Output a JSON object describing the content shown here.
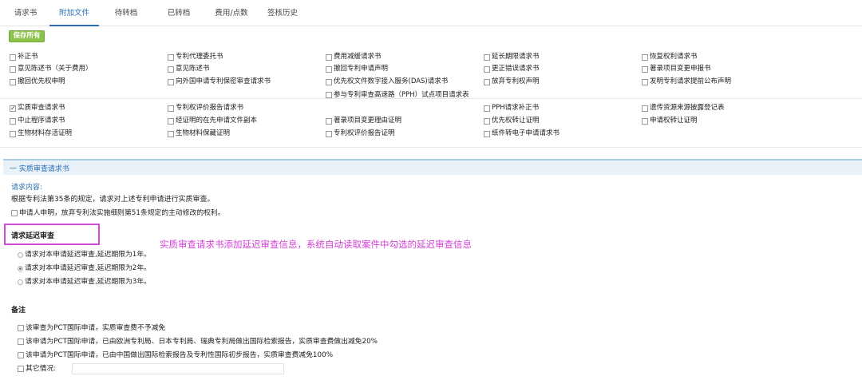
{
  "tabs": [
    "请求书",
    "附加文件",
    "待转档",
    "已转档",
    "费用/点数",
    "签核历史"
  ],
  "save_all": "保存所有",
  "documents": [
    {
      "label": "补正书",
      "checked": false
    },
    {
      "label": "专利代理委托书",
      "checked": false
    },
    {
      "label": "费用减缓请求书",
      "checked": false
    },
    {
      "label": "延长期限请求书",
      "checked": false
    },
    {
      "label": "恢复权利请求书",
      "checked": false
    },
    {
      "label": "意见陈述书（关于费用）",
      "checked": false
    },
    {
      "label": "意见陈述书",
      "checked": false
    },
    {
      "label": "撤回专利申请声明",
      "checked": false
    },
    {
      "label": "更正错误请求书",
      "checked": false
    },
    {
      "label": "著录项目变更申报书",
      "checked": false
    },
    {
      "label": "撤回优先权申明",
      "checked": false
    },
    {
      "label": "向外国申请专利保密审查请求书",
      "checked": false
    },
    {
      "label": "优先权文件数字接入服务(DAS)请求书",
      "checked": false
    },
    {
      "label": "放弃专利权声明",
      "checked": false
    },
    {
      "label": "发明专利请求提前公布声明",
      "checked": false
    },
    {
      "label": "参与专利审查高速路（PPH）试点项目请求表",
      "checked": false
    },
    {
      "label": "实质审查请求书",
      "checked": true
    },
    {
      "label": "专利权评价报告请求书",
      "checked": false
    },
    {
      "label": "PPH请求补正书",
      "checked": false
    },
    {
      "label": "遗传资源来源披露登记表",
      "checked": false
    },
    {
      "label": "中止程序请求书",
      "checked": false
    },
    {
      "label": "经证明的在先申请文件副本",
      "checked": false
    },
    {
      "label": "著录项目变更理由证明",
      "checked": false
    },
    {
      "label": "优先权转让证明",
      "checked": false
    },
    {
      "label": "申请权转让证明",
      "checked": false
    },
    {
      "label": "生物材料存活证明",
      "checked": false
    },
    {
      "label": "生物材料保藏证明",
      "checked": false
    },
    {
      "label": "专利权评价报告证明",
      "checked": false
    },
    {
      "label": "纸件转电子申请请求书",
      "checked": false
    }
  ],
  "section": {
    "title": "一 实质审查请求书",
    "request_content_label": "请求内容:",
    "request_text": "根据专利法第35条的规定，请求对上述专利申请进行实质审查。",
    "waiver_text": "申请人申明，放弃专利法实施细则第51条规定的主动修改的权利。",
    "delay_title": "请求延迟审查",
    "delay_options": [
      {
        "label": "请求对本申请延迟审查,延迟期限为1年。",
        "checked": false
      },
      {
        "label": "请求对本申请延迟审查,延迟期限为2年。",
        "checked": true
      },
      {
        "label": "请求对本申请延迟审查,延迟期限为3年。",
        "checked": false
      }
    ],
    "notes_title": "备注",
    "notes": [
      "该审查为PCT国际申请，实质审查费不予减免",
      "该申请为PCT国际申请，已由欧洲专利局、日本专利局、瑞典专利局做出国际检索报告，实质审查费做出减免20%",
      "该申请为PCT国际申请，已由中国做出国际检索报告及专利性国际初步报告，实质审查费减免100%"
    ],
    "other_label": "其它情况:",
    "other_value": ""
  },
  "annotation": "实质审查请求书添加延迟审查信息，系统自动读取案件中勾选的延迟审查信息",
  "colors": {
    "accent": "#2b6fb5",
    "save_green": "#8bc34a",
    "annotation_magenta": "#d63fd9"
  }
}
